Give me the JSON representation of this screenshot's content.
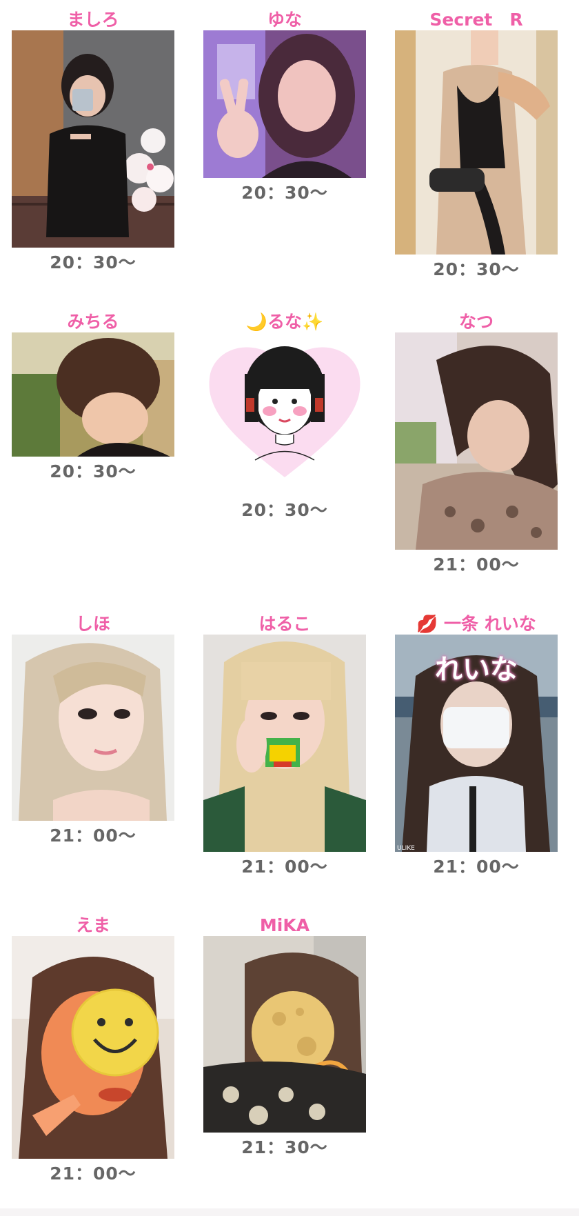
{
  "casts": [
    {
      "name": "ましろ",
      "time": "20：30〜",
      "photo_icon": "person-photo-selfie"
    },
    {
      "name": "ゆな",
      "time": "20：30〜",
      "photo_icon": "person-photo-peace-sign"
    },
    {
      "name": "Secret　R",
      "time": "20：30〜",
      "photo_icon": "person-photo-dress"
    },
    {
      "name": "みちる",
      "time": "20：30〜",
      "photo_icon": "person-photo-updo"
    },
    {
      "name": "🌙るな✨",
      "time": "20：30〜",
      "photo_icon": "illustration-heart-girl"
    },
    {
      "name": "なつ",
      "time": "21：00〜",
      "photo_icon": "person-photo-cherry-blossom"
    },
    {
      "name": "しほ",
      "time": "21：00〜",
      "photo_icon": "person-photo-blonde"
    },
    {
      "name": "はるこ",
      "time": "21：00〜",
      "photo_icon": "person-photo-sticker-face"
    },
    {
      "name": "💋 一条 れいな",
      "time": "21：00〜",
      "photo_icon": "person-photo-mask",
      "photo_overlay_text": "れいな",
      "photo_corner_text": "ULIKE"
    },
    {
      "name": "えま",
      "time": "21：00〜",
      "photo_icon": "person-photo-smiley-face"
    },
    {
      "name": "MiKA",
      "time": "21：30〜",
      "photo_icon": "person-photo-moon-face"
    }
  ],
  "colors": {
    "name": "#ef5fa7",
    "time": "#666666",
    "heart": "#fbdcf0"
  }
}
